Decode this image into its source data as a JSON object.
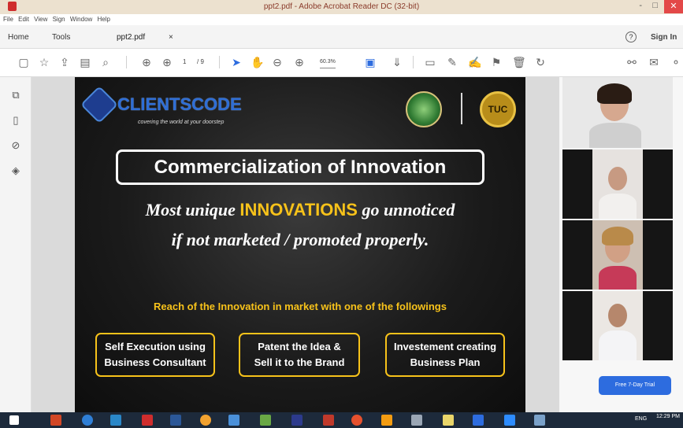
{
  "window": {
    "title": "ppt2.pdf - Adobe Acrobat Reader DC (32-bit)",
    "controls": [
      "-",
      "□",
      "✕"
    ]
  },
  "menu": [
    "File",
    "Edit",
    "View",
    "Sign",
    "Window",
    "Help"
  ],
  "tabs": {
    "home": "Home",
    "tools": "Tools",
    "doc": "ppt2.pdf",
    "doc_close": "×",
    "help_icon": "?",
    "sign_in": "Sign In"
  },
  "toolbar": {
    "page_current": "1",
    "page_total": "/ 9",
    "zoom": "60.3%"
  },
  "slide": {
    "logo_text": "CLIENTSCODE",
    "logo_tagline": "covering the world at your doorstep",
    "seal_right": "TUC",
    "title": "Commercialization of Innovation",
    "line1_before": "Most unique ",
    "line1_highlight": "INNOVATIONS",
    "line1_after": " go unnoticed",
    "line2": "if not marketed / promoted properly.",
    "reach": "Reach of the Innovation in market with one of the followings",
    "options": [
      {
        "line1": "Self Execution using",
        "line2": "Business Consultant"
      },
      {
        "line1": "Patent the Idea &",
        "line2": "Sell it to the Brand"
      },
      {
        "line1": "Investement creating",
        "line2": "Business Plan"
      }
    ]
  },
  "right_panel": {
    "trial_button": "Free 7-Day Trial"
  },
  "taskbar": {
    "lang": "ENG",
    "time": "12:29 PM"
  },
  "colors": {
    "accent_gold": "#f7c21a",
    "acrobat_red": "#cf2d2d",
    "trial_blue": "#2d6cdf"
  },
  "icons": [
    "save-icon",
    "bookmark-star-icon",
    "upload-icon",
    "print-icon",
    "search-icon",
    "page-up-icon",
    "page-down-icon",
    "pointer-icon",
    "hand-icon",
    "zoom-out-icon",
    "zoom-in-icon",
    "fit-page-icon",
    "comment-icon",
    "highlight-icon",
    "draw-icon",
    "stamp-icon",
    "delete-icon",
    "rotate-icon",
    "share-icon",
    "mail-icon"
  ]
}
